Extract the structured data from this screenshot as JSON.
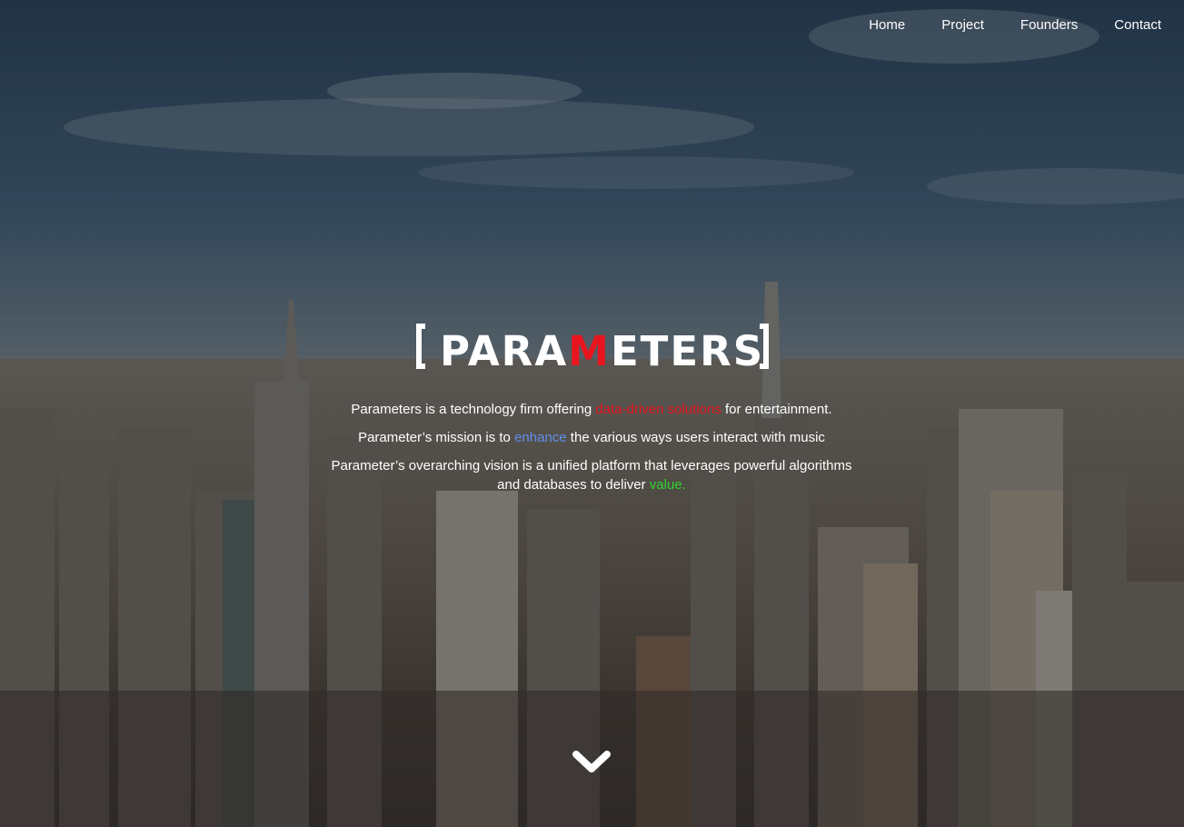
{
  "nav": {
    "items": [
      {
        "label": "Home"
      },
      {
        "label": "Project"
      },
      {
        "label": "Founders"
      },
      {
        "label": "Contact"
      }
    ]
  },
  "logo": {
    "text_before": "PARA",
    "text_accent": "M",
    "text_after": "ETERS"
  },
  "intro": {
    "line1": {
      "before": "Parameters is a technology firm offering ",
      "highlight": "data-driven solutions",
      "after": " for entertainment."
    },
    "line2": {
      "before": "Parameter’s mission is to ",
      "highlight": "enhance",
      "after": " the various ways users interact with music"
    },
    "line3": {
      "before": "Parameter’s overarching vision is a unified platform that leverages powerful algorithms and databases to deliver ",
      "highlight": "value."
    }
  },
  "colors": {
    "accent_red": "#e8151f",
    "accent_blue": "#5f8ee8",
    "accent_green": "#2fd52f",
    "text": "#ffffff"
  },
  "icons": {
    "scroll": "chevron-down-icon"
  }
}
